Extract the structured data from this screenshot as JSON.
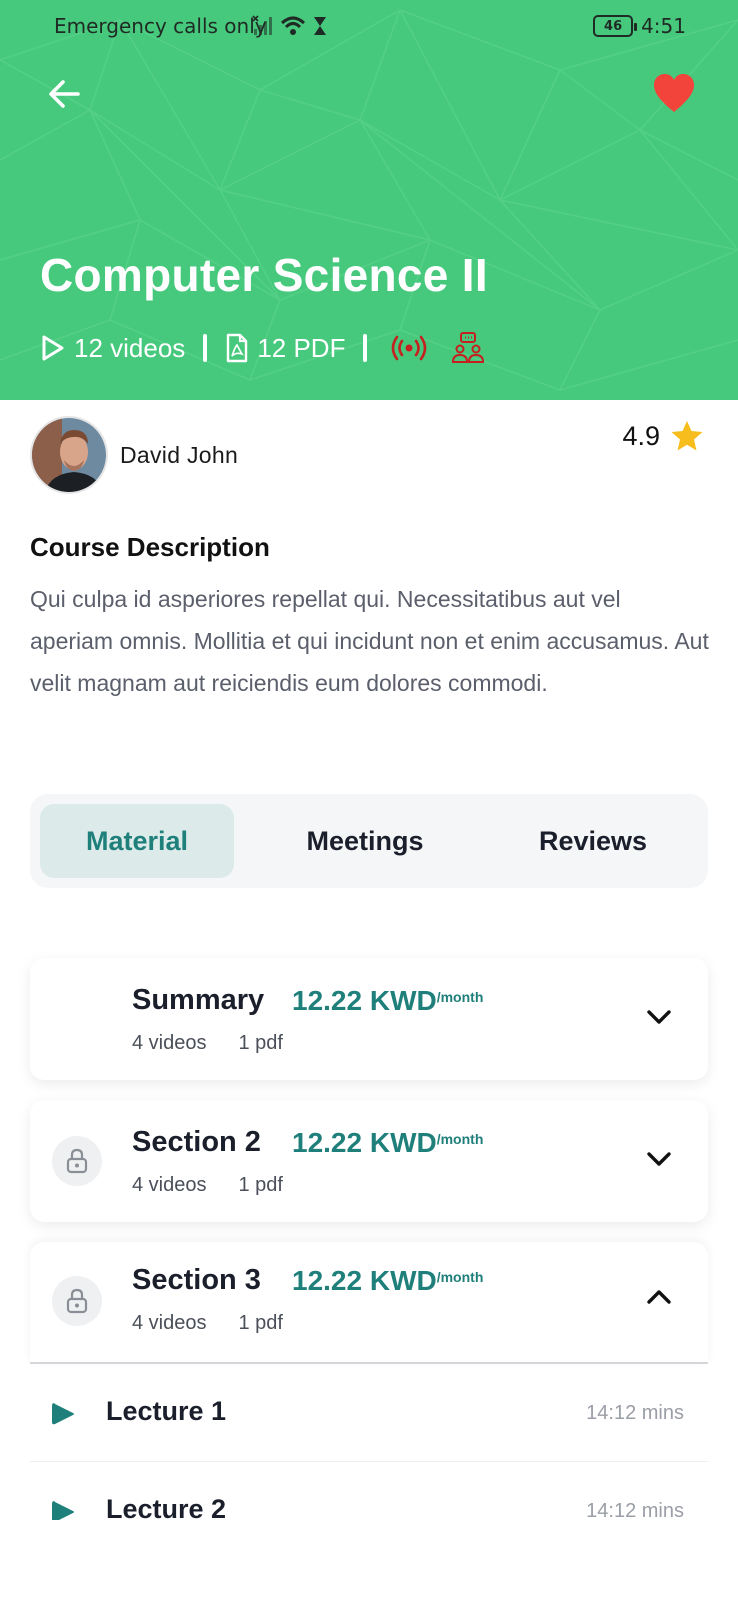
{
  "status": {
    "carrier": "Emergency calls only",
    "battery": "46",
    "time": "4:51"
  },
  "header": {
    "back_icon": "arrow-left-icon",
    "favorite_icon": "heart-icon",
    "title": "Computer Science II",
    "videos": "12 videos",
    "pdfs": "12 PDF",
    "colors": {
      "hero": "#46c97c",
      "live": "#c62020"
    }
  },
  "instructor": {
    "name": "David John",
    "rating": "4.9"
  },
  "description": {
    "title": "Course Description",
    "text": "Qui culpa id asperiores repellat qui. Necessitatibus aut vel aperiam omnis. Mollitia et qui incidunt non et enim accusamus. Aut velit magnam aut reiciendis eum dolores commodi."
  },
  "tabs": [
    {
      "label": "Material",
      "active": true
    },
    {
      "label": "Meetings",
      "active": false
    },
    {
      "label": "Reviews",
      "active": false
    }
  ],
  "sections": [
    {
      "title": "Summary",
      "price": "12.22 KWD",
      "per": "/month",
      "videos": "4 videos",
      "pdf": "1 pdf",
      "locked": false,
      "expanded": false
    },
    {
      "title": "Section 2",
      "price": "12.22 KWD",
      "per": "/month",
      "videos": "4 videos",
      "pdf": "1 pdf",
      "locked": true,
      "expanded": false
    },
    {
      "title": "Section 3",
      "price": "12.22 KWD",
      "per": "/month",
      "videos": "4 videos",
      "pdf": "1 pdf",
      "locked": true,
      "expanded": true
    }
  ],
  "lectures": [
    {
      "name": "Lecture 1",
      "duration": "14:12 mins"
    },
    {
      "name": "Lecture 2",
      "duration": "14:12 mins"
    }
  ],
  "accent": "#1f7f7a"
}
